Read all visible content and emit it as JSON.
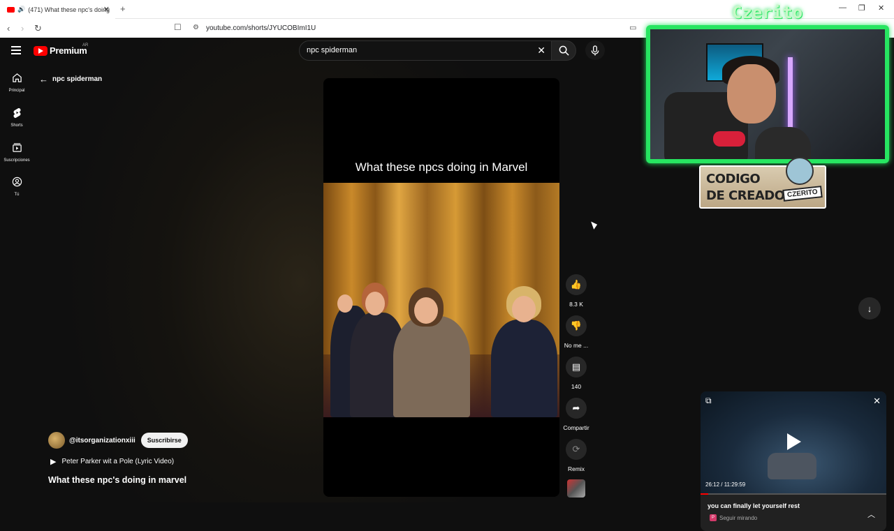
{
  "browser": {
    "tab_title": "(471) What these npc's doing",
    "tab_audio_icon": "speaker-icon",
    "new_tab": "+",
    "url": "youtube.com/shorts/JYUCOBImI1U"
  },
  "header": {
    "logo_text": "Premium",
    "logo_region": "AR",
    "search_value": "npc spiderman"
  },
  "sidebar": {
    "items": [
      {
        "label": "Principal",
        "icon": "home-icon"
      },
      {
        "label": "Shorts",
        "icon": "shorts-icon"
      },
      {
        "label": "Suscripciones",
        "icon": "subscriptions-icon"
      },
      {
        "label": "Tú",
        "icon": "you-icon"
      }
    ]
  },
  "back": {
    "label": "npc spiderman"
  },
  "video": {
    "overlay_title": "What these npcs doing in Marvel"
  },
  "actions": {
    "like_count": "8.3 K",
    "dislike_label": "No me ...",
    "comments_count": "140",
    "share_label": "Compartir",
    "remix_label": "Remix"
  },
  "channel": {
    "name": "@itsorganizationxiii",
    "subscribe_label": "Suscribirse",
    "song": "Peter Parker wit a Pole (Lyric Video)",
    "short_title": "What these npc's doing in marvel"
  },
  "overlay": {
    "streamer_name": "Czerito",
    "creator_code_line1": "CODIGO",
    "creator_code_line2": "DE CREADOR",
    "creator_code_tag": "CZERITO"
  },
  "miniplayer": {
    "time": "26:12 / 11:29:59",
    "progress": 0.04,
    "title": "you can finally let yourself rest",
    "channel_badge": "P",
    "subtitle": "Seguir mirando"
  },
  "colors": {
    "accent": "#ff0000",
    "webcam_border": "#27e561"
  }
}
